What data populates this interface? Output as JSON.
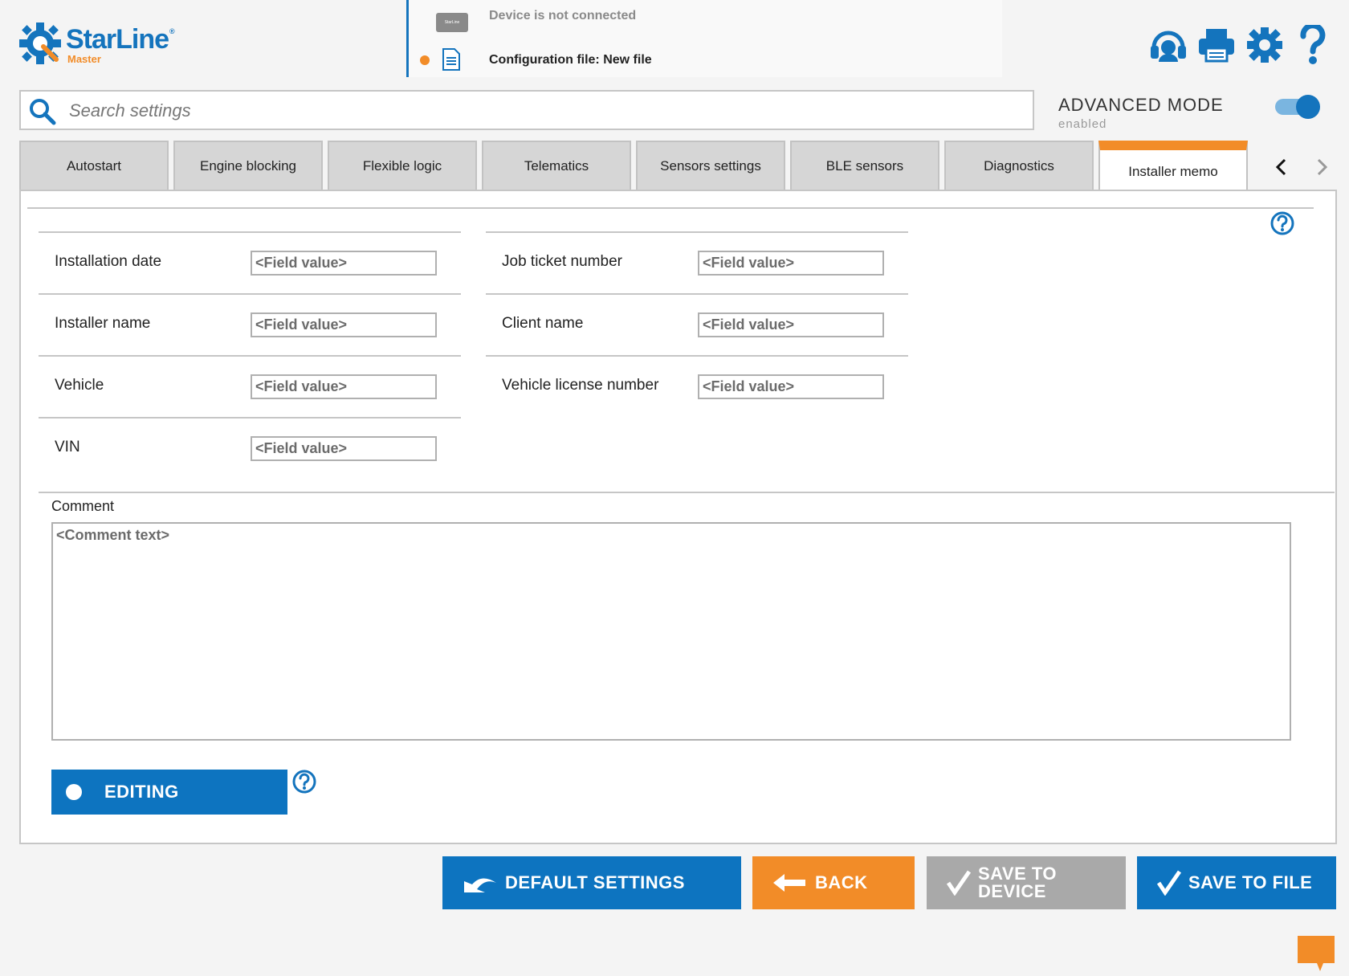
{
  "header": {
    "brand": "StarLine",
    "brand_sub": "Master",
    "device_chip": "StarLine",
    "device_status": "Device is not connected",
    "config_file": "Configuration file: New file"
  },
  "search": {
    "placeholder": "Search settings"
  },
  "advanced_mode": {
    "title": "ADVANCED MODE",
    "state": "enabled",
    "on": true
  },
  "tabs": [
    {
      "label": "Autostart"
    },
    {
      "label": "Engine blocking"
    },
    {
      "label": "Flexible logic"
    },
    {
      "label": "Telematics"
    },
    {
      "label": "Sensors settings"
    },
    {
      "label": "BLE sensors"
    },
    {
      "label": "Diagnostics"
    },
    {
      "label": "Installer memo",
      "active": true
    }
  ],
  "fields_left": [
    {
      "label": "Installation date",
      "placeholder": "<Field value>"
    },
    {
      "label": "Installer name",
      "placeholder": "<Field value>"
    },
    {
      "label": "Vehicle",
      "placeholder": "<Field value>"
    },
    {
      "label": "VIN",
      "placeholder": "<Field value>"
    }
  ],
  "fields_right": [
    {
      "label": "Job ticket number",
      "placeholder": "<Field value>"
    },
    {
      "label": "Client name",
      "placeholder": "<Field value>"
    },
    {
      "label": "Vehicle license number",
      "placeholder": "<Field value>"
    }
  ],
  "comment": {
    "label": "Comment",
    "placeholder": "<Comment text>"
  },
  "editing": {
    "label": "EDITING"
  },
  "footer": {
    "default_settings": "DEFAULT SETTINGS",
    "back": "BACK",
    "save_to_device": "SAVE TO DEVICE",
    "save_to_file": "SAVE TO FILE"
  },
  "colors": {
    "primary": "#0d74c0",
    "accent": "#f28c28",
    "disabled": "#a9a9a9"
  },
  "icons": [
    "support-icon",
    "print-icon",
    "settings-gear-icon",
    "help-question-icon",
    "search-icon",
    "chat-icon"
  ]
}
